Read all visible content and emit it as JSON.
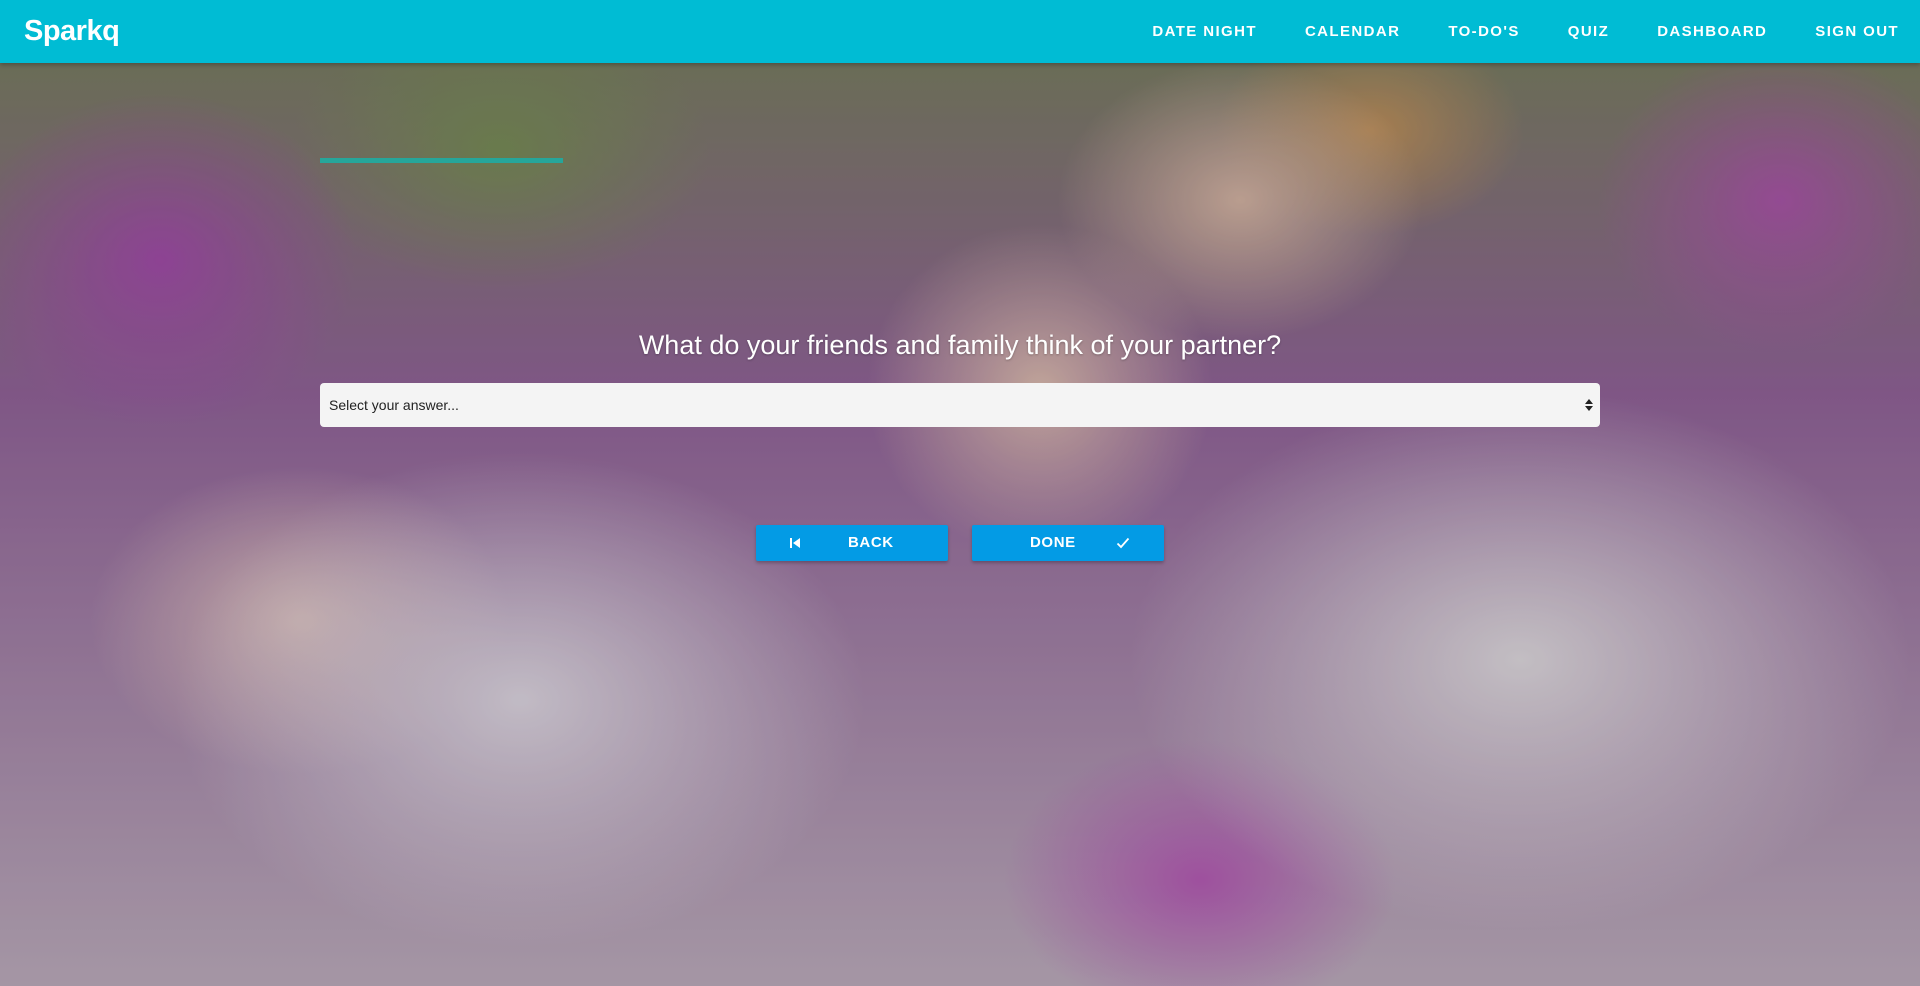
{
  "app": {
    "brand": "Sparkq"
  },
  "nav": {
    "items": [
      {
        "label": "DATE NIGHT"
      },
      {
        "label": "CALENDAR"
      },
      {
        "label": "TO-DO'S"
      },
      {
        "label": "QUIZ"
      },
      {
        "label": "DASHBOARD"
      },
      {
        "label": "SIGN OUT"
      }
    ]
  },
  "quiz": {
    "progress": 0.19,
    "question": "What do your friends and family think of your partner?",
    "answer_select": {
      "selected": "Select your answer..."
    },
    "back_button": {
      "label": "BACK",
      "icon": "skip-previous-icon"
    },
    "done_button": {
      "label": "DONE",
      "icon": "check-icon"
    }
  },
  "colors": {
    "navbar": "#00bcd4",
    "button": "#039be5",
    "progress": "#26a69a"
  }
}
